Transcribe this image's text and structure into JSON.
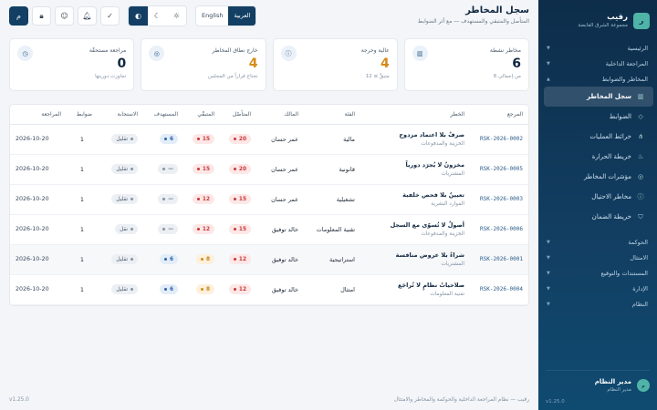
{
  "brand": {
    "logo_letter": "ر",
    "name": "رقيب",
    "subtitle": "مجموعة الشرق القابضة"
  },
  "sidebar": {
    "groups_top": [
      {
        "label": "الرئيسية"
      },
      {
        "label": "المراجعة الداخلية"
      },
      {
        "label": "المخاطر والضوابط"
      }
    ],
    "items": [
      {
        "label": "سجل المخاطر",
        "icon": "chart-icon"
      },
      {
        "label": "الضوابط",
        "icon": "shield-icon"
      },
      {
        "label": "خرائط العمليات",
        "icon": "flow-icon"
      },
      {
        "label": "خريطة الحرارة",
        "icon": "flame-icon"
      },
      {
        "label": "مؤشرات المخاطر",
        "icon": "target-icon"
      },
      {
        "label": "مخاطر الاحتيال",
        "icon": "alert-icon"
      },
      {
        "label": "خريطة الضمان",
        "icon": "check-shield-icon"
      }
    ],
    "groups_bottom": [
      {
        "label": "الحوكمة"
      },
      {
        "label": "الامتثال"
      },
      {
        "label": "المستندات والتوقيع"
      },
      {
        "label": "الإدارة"
      },
      {
        "label": "النظام"
      }
    ],
    "user": {
      "avatar": "م",
      "name": "مدير النظام",
      "role": "مدير النظام"
    },
    "version": "v1.25.0"
  },
  "header": {
    "title": "سجل المخاطر",
    "subtitle": "المتأصل والمتبقي والمستهدف — مع أثر الضوابط",
    "lang_ar": "العربية",
    "lang_en": "English",
    "avatar_letter": "م"
  },
  "cards": [
    {
      "label": "مخاطر نشطة",
      "value": "6",
      "note": "من إجمالي 6",
      "icon": "chart-icon",
      "accent": false
    },
    {
      "label": "عالية وحرجة",
      "value": "4",
      "note": "متبقٍّ ≥ 12",
      "icon": "alert-icon",
      "accent": true
    },
    {
      "label": "خارج نطاق المخاطر",
      "value": "4",
      "note": "تحتاج قراراً من المجلس",
      "icon": "target-icon",
      "accent": true
    },
    {
      "label": "مراجعة مستحقّة",
      "value": "0",
      "note": "تجاوزت دوريتها",
      "icon": "clock-icon",
      "accent": false
    }
  ],
  "table": {
    "columns": [
      "المرجع",
      "الخطر",
      "الفئة",
      "المالك",
      "المتأصّل",
      "المتبقّي",
      "المستهدف",
      "الاستجابة",
      "ضوابط",
      "المراجعة"
    ],
    "rows": [
      {
        "ref": "RSK-2026-0002",
        "title": "صرفٌ بلا اعتماد مزدوج",
        "dept": "الخزينة والمدفوعات",
        "category": "مالية",
        "owner": "عمر حسان",
        "inherent": "20",
        "residual": "15",
        "target": "6",
        "response": "تقليل",
        "controls": "1",
        "review": "2026-10-20",
        "ic": "red",
        "rc": "red",
        "tc": "blue",
        "hl": false
      },
      {
        "ref": "RSK-2026-0005",
        "title": "مخزونٌ لا يُجرَد دورياً",
        "dept": "المشتريات",
        "category": "قانونية",
        "owner": "عمر حسان",
        "inherent": "20",
        "residual": "15",
        "target": "—",
        "response": "تقليل",
        "controls": "1",
        "review": "2026-10-20",
        "ic": "red",
        "rc": "red",
        "tc": "grey",
        "hl": false
      },
      {
        "ref": "RSK-2026-0003",
        "title": "تعيينٌ بلا فحص خلفية",
        "dept": "الموارد البشرية",
        "category": "تشغيلية",
        "owner": "عمر حسان",
        "inherent": "15",
        "residual": "12",
        "target": "—",
        "response": "تقليل",
        "controls": "1",
        "review": "2026-10-20",
        "ic": "red",
        "rc": "red",
        "tc": "grey",
        "hl": false
      },
      {
        "ref": "RSK-2026-0006",
        "title": "أصولٌ لا تُسوّى مع السجل",
        "dept": "الخزينة والمدفوعات",
        "category": "تقنية المعلومات",
        "owner": "خالد توفيق",
        "inherent": "15",
        "residual": "12",
        "target": "—",
        "response": "نقل",
        "controls": "1",
        "review": "2026-10-20",
        "ic": "red",
        "rc": "red",
        "tc": "grey",
        "hl": false
      },
      {
        "ref": "RSK-2026-0001",
        "title": "شراءٌ بلا عروض منافسة",
        "dept": "المشتريات",
        "category": "استراتيجية",
        "owner": "خالد توفيق",
        "inherent": "12",
        "residual": "8",
        "target": "6",
        "response": "تقليل",
        "controls": "1",
        "review": "2026-10-20",
        "ic": "red",
        "rc": "amber",
        "tc": "blue",
        "hl": true
      },
      {
        "ref": "RSK-2026-0004",
        "title": "صلاحياتُ نظامٍ لا تُراجَع",
        "dept": "تقنية المعلومات",
        "category": "امتثال",
        "owner": "خالد توفيق",
        "inherent": "12",
        "residual": "8",
        "target": "6",
        "response": "تقليل",
        "controls": "1",
        "review": "2026-10-20",
        "ic": "red",
        "rc": "amber",
        "tc": "blue",
        "hl": false
      }
    ]
  },
  "footer": {
    "left": "رقيب — نظام المراجعة الداخلية والحوكمة والمخاطر والامتثال",
    "right": "v1.25.0"
  },
  "colors": {
    "sidebar": "#123f63",
    "accent": "#d68a19",
    "danger": "#c73838",
    "info": "#2b63a8"
  }
}
